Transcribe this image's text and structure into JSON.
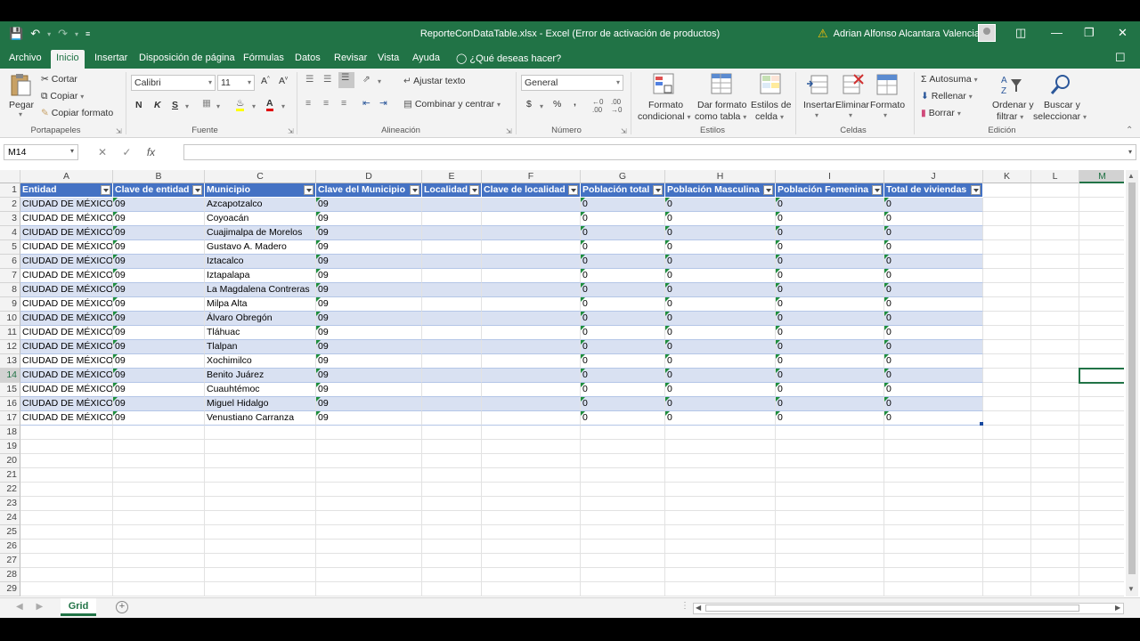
{
  "title": {
    "document": "ReporteConDataTable.xlsx  -  Excel (Error de activación de productos)",
    "user": "Adrian Alfonso Alcantara Valencia"
  },
  "tabs": [
    "Archivo",
    "Inicio",
    "Insertar",
    "Disposición de página",
    "Fórmulas",
    "Datos",
    "Revisar",
    "Vista",
    "Ayuda"
  ],
  "tell_me": "¿Qué deseas hacer?",
  "ribbon": {
    "clipboard": {
      "paste": "Pegar",
      "cut": "Cortar",
      "copy": "Copiar",
      "format_painter": "Copiar formato",
      "label": "Portapapeles"
    },
    "font": {
      "name": "Calibri",
      "size": "11",
      "bold": "N",
      "italic": "K",
      "underline": "S",
      "label": "Fuente"
    },
    "alignment": {
      "wrap": "Ajustar texto",
      "merge": "Combinar y centrar",
      "label": "Alineación"
    },
    "number": {
      "format": "General",
      "currency": "$",
      "percent": "%",
      "comma": ",",
      "label": "Número"
    },
    "styles": {
      "cond_format_1": "Formato",
      "cond_format_2": "condicional",
      "as_table_1": "Dar formato",
      "as_table_2": "como tabla",
      "cell_styles_1": "Estilos de",
      "cell_styles_2": "celda",
      "label": "Estilos"
    },
    "cells": {
      "insert": "Insertar",
      "delete": "Eliminar",
      "format": "Formato",
      "label": "Celdas"
    },
    "editing": {
      "autosum": "Autosuma",
      "fill": "Rellenar",
      "clear": "Borrar",
      "sort_1": "Ordenar y",
      "sort_2": "filtrar",
      "find_1": "Buscar y",
      "find_2": "seleccionar",
      "label": "Edición"
    }
  },
  "name_box": "M14",
  "fx": "fx",
  "columns": [
    "A",
    "B",
    "C",
    "D",
    "E",
    "F",
    "G",
    "H",
    "I",
    "J",
    "K",
    "L",
    "M"
  ],
  "table_headers": [
    "Entidad",
    "Clave de entidad",
    "Municipio",
    "Clave del Municipio",
    "Localidad",
    "Clave de localidad",
    "Población total",
    "Población Masculina",
    "Población Femenina",
    "Total de viviendas"
  ],
  "rows": [
    [
      "CIUDAD DE MÉXICO",
      "09",
      "Azcapotzalco",
      "09",
      "",
      "",
      "0",
      "0",
      "0",
      "0"
    ],
    [
      "CIUDAD DE MÉXICO",
      "09",
      "Coyoacán",
      "09",
      "",
      "",
      "0",
      "0",
      "0",
      "0"
    ],
    [
      "CIUDAD DE MÉXICO",
      "09",
      "Cuajimalpa de Morelos",
      "09",
      "",
      "",
      "0",
      "0",
      "0",
      "0"
    ],
    [
      "CIUDAD DE MÉXICO",
      "09",
      "Gustavo A. Madero",
      "09",
      "",
      "",
      "0",
      "0",
      "0",
      "0"
    ],
    [
      "CIUDAD DE MÉXICO",
      "09",
      "Iztacalco",
      "09",
      "",
      "",
      "0",
      "0",
      "0",
      "0"
    ],
    [
      "CIUDAD DE MÉXICO",
      "09",
      "Iztapalapa",
      "09",
      "",
      "",
      "0",
      "0",
      "0",
      "0"
    ],
    [
      "CIUDAD DE MÉXICO",
      "09",
      "La Magdalena Contreras",
      "09",
      "",
      "",
      "0",
      "0",
      "0",
      "0"
    ],
    [
      "CIUDAD DE MÉXICO",
      "09",
      "Milpa Alta",
      "09",
      "",
      "",
      "0",
      "0",
      "0",
      "0"
    ],
    [
      "CIUDAD DE MÉXICO",
      "09",
      "Álvaro Obregón",
      "09",
      "",
      "",
      "0",
      "0",
      "0",
      "0"
    ],
    [
      "CIUDAD DE MÉXICO",
      "09",
      "Tláhuac",
      "09",
      "",
      "",
      "0",
      "0",
      "0",
      "0"
    ],
    [
      "CIUDAD DE MÉXICO",
      "09",
      "Tlalpan",
      "09",
      "",
      "",
      "0",
      "0",
      "0",
      "0"
    ],
    [
      "CIUDAD DE MÉXICO",
      "09",
      "Xochimilco",
      "09",
      "",
      "",
      "0",
      "0",
      "0",
      "0"
    ],
    [
      "CIUDAD DE MÉXICO",
      "09",
      "Benito Juárez",
      "09",
      "",
      "",
      "0",
      "0",
      "0",
      "0"
    ],
    [
      "CIUDAD DE MÉXICO",
      "09",
      "Cuauhtémoc",
      "09",
      "",
      "",
      "0",
      "0",
      "0",
      "0"
    ],
    [
      "CIUDAD DE MÉXICO",
      "09",
      "Miguel Hidalgo",
      "09",
      "",
      "",
      "0",
      "0",
      "0",
      "0"
    ],
    [
      "CIUDAD DE MÉXICO",
      "09",
      "Venustiano Carranza",
      "09",
      "",
      "",
      "0",
      "0",
      "0",
      "0"
    ]
  ],
  "row_numbers": [
    "1",
    "2",
    "3",
    "4",
    "5",
    "6",
    "7",
    "8",
    "9",
    "10",
    "11",
    "12",
    "13",
    "14",
    "15",
    "16",
    "17",
    "18",
    "19",
    "20",
    "21",
    "22",
    "23",
    "24",
    "25",
    "26",
    "27",
    "28",
    "29"
  ],
  "selected": {
    "column": "M",
    "row": "14"
  },
  "sheet_tab": "Grid",
  "colors": {
    "brand": "#217346",
    "table_header": "#4472c4",
    "band": "#d9e1f2"
  }
}
